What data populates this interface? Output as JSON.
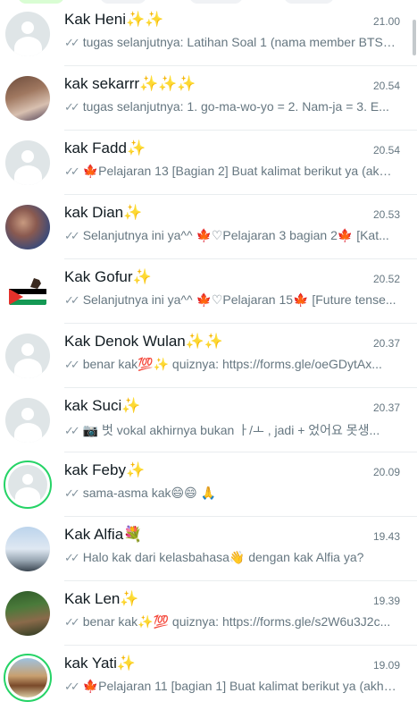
{
  "chats": [
    {
      "name": "Kak Heni",
      "emoji": "✨✨",
      "time": "21.00",
      "preview": "tugas selanjutnya: Latihan Soal 1 (nama member BTS) 1...",
      "avatar": "placeholder"
    },
    {
      "name": "kak sekarrr",
      "emoji": "✨✨✨",
      "time": "20.54",
      "preview": "tugas selanjutnya: 1. go-ma-wo-yo = 2. Nam-ja = 3. E...",
      "avatar": "photo-people"
    },
    {
      "name": "kak Fadd",
      "emoji": "✨",
      "time": "20.54",
      "preview": "🍁Pelajaran 13 [Bagian 2] Buat kalimat berikut ya (akhi...",
      "avatar": "placeholder"
    },
    {
      "name": "kak Dian",
      "emoji": "✨",
      "time": "20.53",
      "preview": "Selanjutnya ini ya^^ 🍁♡Pelajaran 3 bagian 2🍁 [Kat...",
      "avatar": "photo-family"
    },
    {
      "name": "Kak Gofur",
      "emoji": "✨",
      "time": "20.52",
      "preview": "Selanjutnya ini ya^^ 🍁♡Pelajaran 15🍁 [Future tense...",
      "avatar": "photo-flag"
    },
    {
      "name": "Kak Denok Wulan",
      "emoji": "✨✨",
      "time": "20.37",
      "preview": "benar kak💯✨ quiznya: https://forms.gle/oeGDytAx...",
      "avatar": "placeholder"
    },
    {
      "name": "kak Suci",
      "emoji": "✨",
      "time": "20.37",
      "preview": "📷 벗 vokal akhirnya bukan ㅏ/ㅗ , jadi + 었어요 못생...",
      "avatar": "placeholder"
    },
    {
      "name": "kak Feby",
      "emoji": "✨",
      "time": "20.09",
      "preview": "sama-asma kak😄😄 🙏",
      "avatar": "placeholder-ring"
    },
    {
      "name": "Kak Alfia",
      "emoji": "💐",
      "time": "19.43",
      "preview": "Halo kak dari kelasbahasa👋 dengan kak Alfia ya?",
      "avatar": "photo-sky"
    },
    {
      "name": "Kak Len",
      "emoji": "✨",
      "time": "19.39",
      "preview": "benar kak✨💯 quiznya: https://forms.gle/s2W6u3J2c...",
      "avatar": "photo-forest"
    },
    {
      "name": "kak Yati",
      "emoji": "✨",
      "time": "19.09",
      "preview": "🍁Pelajaran 11 [bagian 1] Buat kalimat berikut ya (akhi...",
      "avatar": "photo-temple-ring"
    }
  ],
  "icons": {
    "read_receipt": "double-check-icon"
  }
}
